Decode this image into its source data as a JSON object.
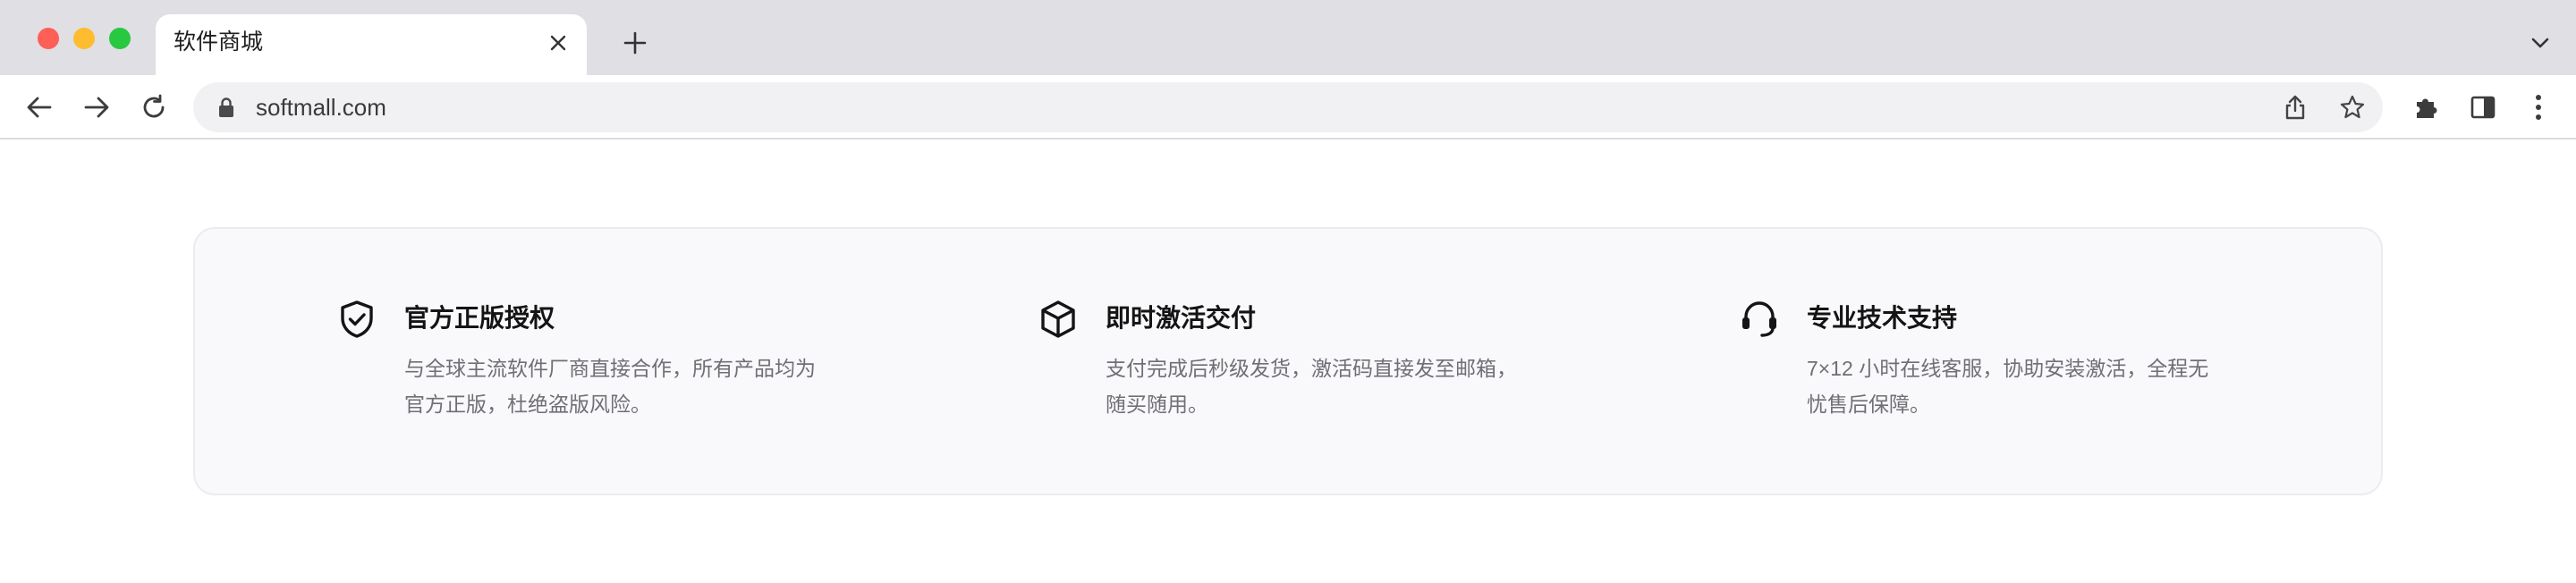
{
  "browser": {
    "tab": {
      "title": "软件商城"
    },
    "address_bar": {
      "url": "softmall.com"
    }
  },
  "features": [
    {
      "icon": "shield-check-icon",
      "title": "官方正版授权",
      "desc_lines": [
        "与全球主流软件厂商直接合作，所有产品均为",
        "官方正版，杜绝盗版风险。"
      ]
    },
    {
      "icon": "box-icon",
      "title": "即时激活交付",
      "desc_lines": [
        "支付完成后秒级发货，激活码直接发至邮箱，",
        "随买随用。"
      ]
    },
    {
      "icon": "headset-icon",
      "title": "专业技术支持",
      "desc_lines": [
        "7×12 小时在线客服，协助安装激活，全程无",
        "忧售后保障。"
      ]
    }
  ],
  "colors": {
    "tabstrip": "#dfdfe4",
    "card_bg": "#f9f8fb",
    "title": "#141414",
    "desc": "#6f6f76"
  }
}
